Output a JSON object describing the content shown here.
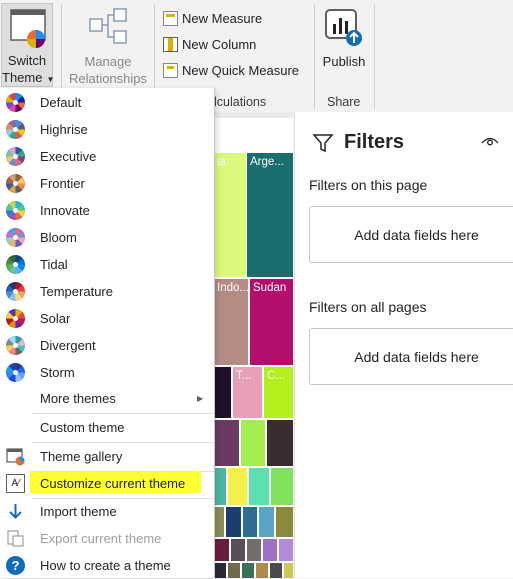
{
  "ribbon": {
    "switch_theme": [
      "Switch",
      "Theme"
    ],
    "manage_relationships": [
      "Manage",
      "Relationships"
    ],
    "new_measure": "New Measure",
    "new_column": "New Column",
    "new_quick_measure": "New Quick Measure",
    "calculations_label": "lculations",
    "publish": "Publish",
    "share_label": "Share"
  },
  "menu": {
    "themes": [
      {
        "label": "Default",
        "colors": [
          "#118DFF",
          "#12239E",
          "#E66C37",
          "#6B007B",
          "#E044A7",
          "#744EC2",
          "#D9B300",
          "#D64550"
        ]
      },
      {
        "label": "Highrise",
        "colors": [
          "#4A8DDC",
          "#4C5D8A",
          "#F3C911",
          "#DC5B57",
          "#33AE81",
          "#95C8F0",
          "#DD915F",
          "#9A64A0"
        ]
      },
      {
        "label": "Executive",
        "colors": [
          "#3257A8",
          "#37A794",
          "#8B3D88",
          "#DD6B7F",
          "#6B91C9",
          "#F5C869",
          "#77C4A8",
          "#DEA6CF"
        ]
      },
      {
        "label": "Frontier",
        "colors": [
          "#936437",
          "#FFC75F",
          "#F28A45",
          "#5C6068",
          "#E8A33A",
          "#3F5E94",
          "#B05E3B",
          "#C9A477"
        ]
      },
      {
        "label": "Innovate",
        "colors": [
          "#1CB9E2",
          "#4FC98A",
          "#F3D44B",
          "#E66C37",
          "#8E5BC3",
          "#2F7ED8",
          "#5BC2A7",
          "#C2D94B"
        ]
      },
      {
        "label": "Bloom",
        "colors": [
          "#E56B8A",
          "#7D8CD6",
          "#F5A5B8",
          "#5D5FD1",
          "#F2B36A",
          "#8ED6C7",
          "#C56BD6",
          "#4E9FE5"
        ]
      },
      {
        "label": "Tidal",
        "colors": [
          "#094782",
          "#0B72D7",
          "#098BF5",
          "#54B5FB",
          "#71C0A7",
          "#57B956",
          "#478F48",
          "#326633"
        ]
      },
      {
        "label": "Temperature",
        "colors": [
          "#B40D1E",
          "#E43F3B",
          "#F7A35C",
          "#FCD77F",
          "#8FC3E8",
          "#4B8FD6",
          "#2D5FB3",
          "#1B3A7A"
        ]
      },
      {
        "label": "Solar",
        "colors": [
          "#E6B300",
          "#E24C2F",
          "#C2185B",
          "#7B1FA2",
          "#F08C00",
          "#B71C1C",
          "#F4D03F",
          "#5E35B1"
        ]
      },
      {
        "label": "Divergent",
        "colors": [
          "#3599B8",
          "#DFBFBF",
          "#4AC5BB",
          "#5F6B6D",
          "#FB8281",
          "#F4D25A",
          "#7F898A",
          "#A4DDEE"
        ]
      },
      {
        "label": "Storm",
        "colors": [
          "#1E3A8A",
          "#2563EB",
          "#60A5FA",
          "#93C5FD",
          "#1D4ED8",
          "#3B82F6",
          "#0EA5E9",
          "#1E40AF"
        ]
      }
    ],
    "more_themes": "More themes",
    "custom_theme": "Custom theme",
    "theme_gallery": "Theme gallery",
    "customize_current_theme": "Customize current theme",
    "import_theme": "Import theme",
    "export_current_theme": "Export current theme",
    "how_to_create": "How to create a theme",
    "highlight_color": "#FFFF33"
  },
  "canvas": {
    "labels": [
      "ia",
      "Arge...",
      "Indo...",
      "Sudan",
      "T...",
      "C..."
    ]
  },
  "filters": {
    "title": "Filters",
    "on_this_page": "Filters on this page",
    "on_all_pages": "Filters on all pages",
    "add_fields_1": "Add data fields here",
    "add_fields_2": "Add data fields here"
  }
}
